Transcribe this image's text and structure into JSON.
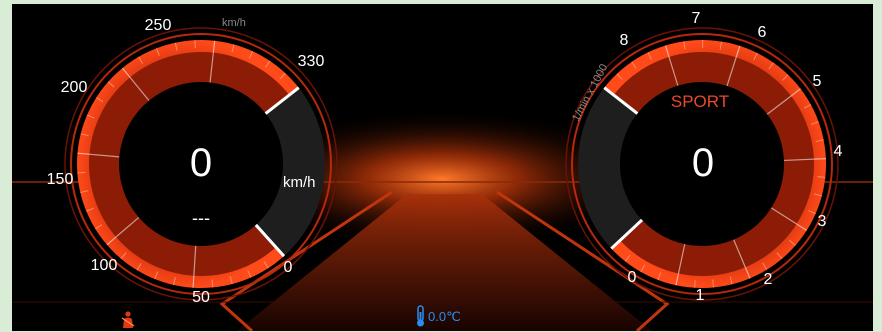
{
  "speedometer": {
    "value": "0",
    "unit_label": "km/h",
    "unit_small": "km/h",
    "secondary": "---",
    "max_value": 330,
    "ticks": [
      "0",
      "50",
      "100",
      "150",
      "200",
      "250",
      "330"
    ]
  },
  "tachometer": {
    "value": "0",
    "mode": "SPORT",
    "unit_label": "1/min x 1000",
    "max_value": 8,
    "ticks": [
      "0",
      "1",
      "2",
      "3",
      "4",
      "5",
      "6",
      "7",
      "8"
    ]
  },
  "status_bar": {
    "temperature": "0.0℃",
    "seatbelt_icon": "seatbelt-warning-icon",
    "temperature_icon": "thermometer-icon"
  },
  "colors": {
    "accent": "#e03a10",
    "accent_dark": "#7a1505",
    "background": "#000000",
    "frame": "#d8ecd6",
    "temp_blue": "#2a8cf0",
    "mode_red": "#e84a2a"
  }
}
